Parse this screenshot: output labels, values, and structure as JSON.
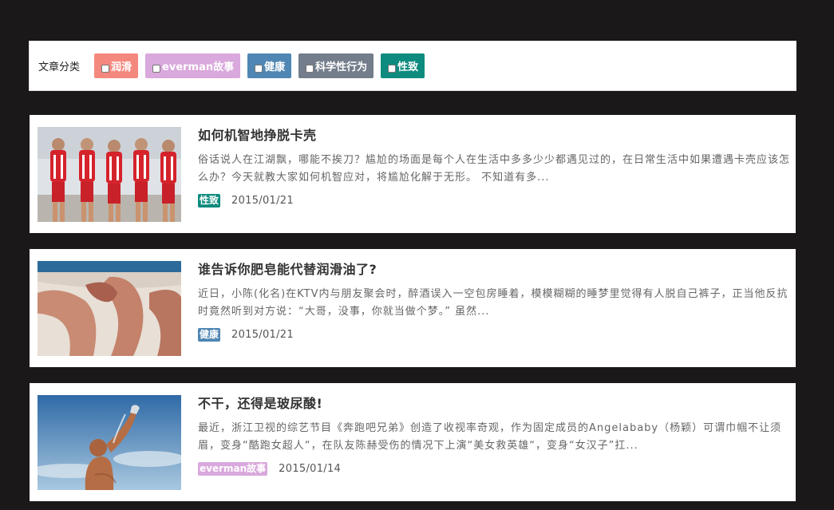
{
  "filter": {
    "label": "文章分类",
    "tags": [
      {
        "label": "润滑",
        "color": "#f5887e"
      },
      {
        "label": "everman故事",
        "color": "#d9a8dc"
      },
      {
        "label": "健康",
        "color": "#4f86b3"
      },
      {
        "label": "科学性行为",
        "color": "#737d8b"
      },
      {
        "label": "性致",
        "color": "#0d8b7e"
      }
    ]
  },
  "articles": [
    {
      "title": "如何机智地挣脱卡壳",
      "excerpt": "俗话说人在江湖飘，哪能不挨刀？尴尬的场面是每个人在生活中多多少少都遇见过的，在日常生活中如果遭遇卡壳应该怎么办？今天就教大家如何机智应对，将尴尬化解于无形。 不知道有多...",
      "category": "性致",
      "category_color": "#0d8b7e",
      "date": "2015/01/21",
      "thumb_icon": "cyclists-photo"
    },
    {
      "title": "谁告诉你肥皂能代替润滑油了?",
      "excerpt": "近日，小陈(化名)在KTV内与朋友聚会时，醉酒误入一空包房睡着，模模糊糊的睡梦里觉得有人脱自己裤子，正当他反抗时竟然听到对方说：“大哥，没事，你就当做个梦。” 虽然...",
      "category": "健康",
      "category_color": "#4f86b3",
      "date": "2015/01/21",
      "thumb_icon": "legs-photo"
    },
    {
      "title": "不干，还得是玻尿酸!",
      "excerpt": "最近，浙江卫视的综艺节目《奔跑吧兄弟》创造了收视率奇观，作为固定成员的Angelababy（杨颖）可谓巾帼不让须眉，变身“酷跑女超人“，在队友陈赫受伤的情况下上演“美女救英雄“，变身“女汉子”扛...",
      "category": "everman故事",
      "category_color": "#d9a8dc",
      "date": "2015/01/14",
      "thumb_icon": "drinking-man-photo"
    }
  ]
}
